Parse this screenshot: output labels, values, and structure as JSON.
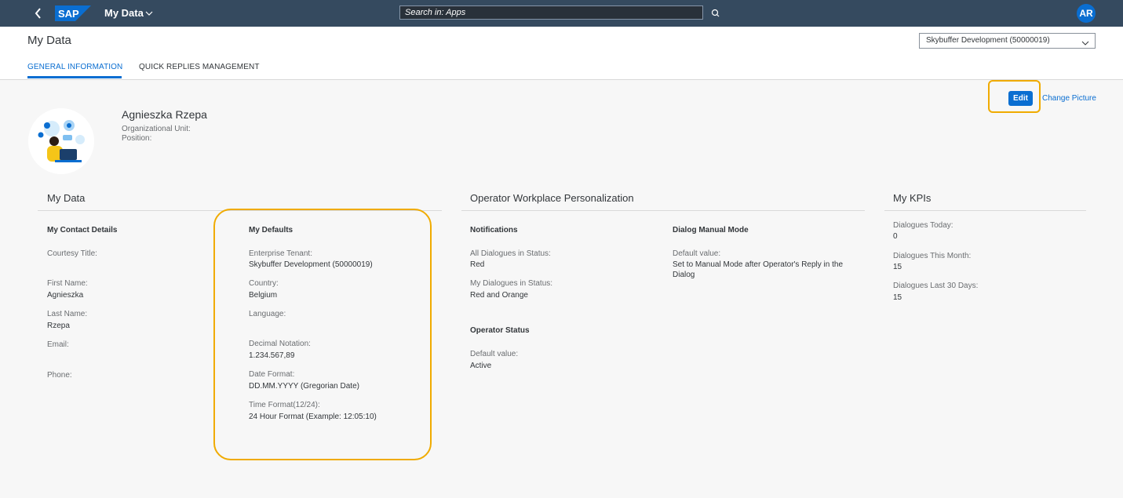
{
  "shell": {
    "logo_text": "SAP",
    "app_title": "My Data",
    "search_placeholder": "Search in: Apps",
    "avatar_initials": "AR",
    "colors": {
      "shell_bg": "#354a5f",
      "accent": "#0a6ed1",
      "highlight": "#f0ab00"
    }
  },
  "header": {
    "page_title": "My Data",
    "tenant_select": "Skybuffer Development (50000019)",
    "tabs": [
      {
        "label": "GENERAL INFORMATION",
        "selected": true
      },
      {
        "label": "QUICK REPLIES MANAGEMENT",
        "selected": false
      }
    ]
  },
  "actions": {
    "edit": "Edit",
    "change_picture": "Change Picture"
  },
  "profile": {
    "name": "Agnieszka Rzepa",
    "org_unit_label": "Organizational Unit:",
    "position_label": "Position:"
  },
  "my_data": {
    "title": "My Data",
    "contact": {
      "title": "My Contact Details",
      "courtesy_label": "Courtesy Title:",
      "first_name_label": "First Name:",
      "first_name": "Agnieszka",
      "last_name_label": "Last Name:",
      "last_name": "Rzepa",
      "email_label": "Email:",
      "phone_label": "Phone:"
    },
    "defaults": {
      "title": "My Defaults",
      "tenant_label": "Enterprise Tenant:",
      "tenant": "Skybuffer Development (50000019)",
      "country_label": "Country:",
      "country": "Belgium",
      "language_label": "Language:",
      "decimal_label": "Decimal Notation:",
      "decimal": "1.234.567,89",
      "date_label": "Date Format:",
      "date": "DD.MM.YYYY (Gregorian Date)",
      "time_label": "Time Format(12/24):",
      "time": "24 Hour Format (Example: 12:05:10)"
    }
  },
  "personalization": {
    "title": "Operator Workplace Personalization",
    "notifications": {
      "title": "Notifications",
      "all_label": "All Dialogues in Status:",
      "all_value": "Red",
      "my_label": "My Dialogues in Status:",
      "my_value": "Red and Orange"
    },
    "manual_mode": {
      "title": "Dialog Manual Mode",
      "default_label": "Default value:",
      "default_value_line1": "Set to Manual Mode after Operator's Reply in the",
      "default_value_line2": "Dialog"
    },
    "status": {
      "title": "Operator Status",
      "default_label": "Default value:",
      "default_value": "Active"
    }
  },
  "kpis": {
    "title": "My KPIs",
    "today_label": "Dialogues Today:",
    "today": "0",
    "month_label": "Dialogues This Month:",
    "month": "15",
    "last30_label": "Dialogues Last 30 Days:",
    "last30": "15"
  }
}
